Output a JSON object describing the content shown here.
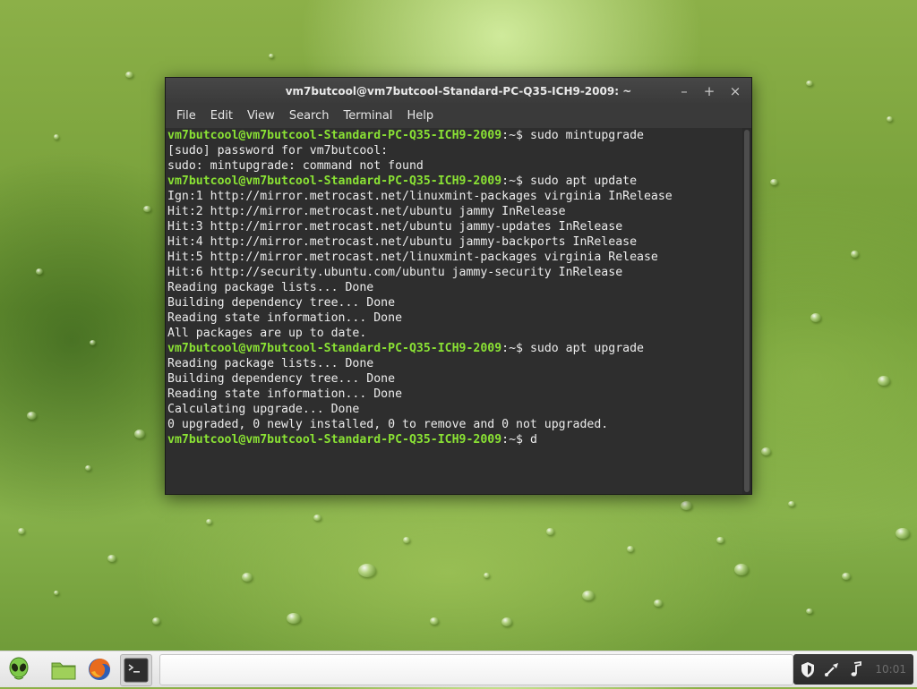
{
  "window": {
    "title": "vm7butcool@vm7butcool-Standard-PC-Q35-ICH9-2009: ~",
    "controls": {
      "minimize": "–",
      "maximize": "+",
      "close": "×"
    }
  },
  "menu": {
    "items": [
      {
        "label": "File"
      },
      {
        "label": "Edit"
      },
      {
        "label": "View"
      },
      {
        "label": "Search"
      },
      {
        "label": "Terminal"
      },
      {
        "label": "Help"
      }
    ]
  },
  "terminal": {
    "lines": [
      {
        "prompt": "vm7butcool@vm7butcool-Standard-PC-Q35-ICH9-2009",
        "sep": ":~$",
        "text": " sudo mintupgrade"
      },
      {
        "prompt": "",
        "sep": "",
        "text": "[sudo] password for vm7butcool:"
      },
      {
        "prompt": "",
        "sep": "",
        "text": "sudo: mintupgrade: command not found"
      },
      {
        "prompt": "vm7butcool@vm7butcool-Standard-PC-Q35-ICH9-2009",
        "sep": ":~$",
        "text": " sudo apt update"
      },
      {
        "prompt": "",
        "sep": "",
        "text": "Ign:1 http://mirror.metrocast.net/linuxmint-packages virginia InRelease"
      },
      {
        "prompt": "",
        "sep": "",
        "text": "Hit:2 http://mirror.metrocast.net/ubuntu jammy InRelease"
      },
      {
        "prompt": "",
        "sep": "",
        "text": "Hit:3 http://mirror.metrocast.net/ubuntu jammy-updates InRelease"
      },
      {
        "prompt": "",
        "sep": "",
        "text": "Hit:4 http://mirror.metrocast.net/ubuntu jammy-backports InRelease"
      },
      {
        "prompt": "",
        "sep": "",
        "text": "Hit:5 http://mirror.metrocast.net/linuxmint-packages virginia Release"
      },
      {
        "prompt": "",
        "sep": "",
        "text": "Hit:6 http://security.ubuntu.com/ubuntu jammy-security InRelease"
      },
      {
        "prompt": "",
        "sep": "",
        "text": "Reading package lists... Done"
      },
      {
        "prompt": "",
        "sep": "",
        "text": "Building dependency tree... Done"
      },
      {
        "prompt": "",
        "sep": "",
        "text": "Reading state information... Done"
      },
      {
        "prompt": "",
        "sep": "",
        "text": "All packages are up to date."
      },
      {
        "prompt": "vm7butcool@vm7butcool-Standard-PC-Q35-ICH9-2009",
        "sep": ":~$",
        "text": " sudo apt upgrade"
      },
      {
        "prompt": "",
        "sep": "",
        "text": "Reading package lists... Done"
      },
      {
        "prompt": "",
        "sep": "",
        "text": "Building dependency tree... Done"
      },
      {
        "prompt": "",
        "sep": "",
        "text": "Reading state information... Done"
      },
      {
        "prompt": "",
        "sep": "",
        "text": "Calculating upgrade... Done"
      },
      {
        "prompt": "",
        "sep": "",
        "text": "0 upgraded, 0 newly installed, 0 to remove and 0 not upgraded."
      },
      {
        "prompt": "vm7butcool@vm7butcool-Standard-PC-Q35-ICH9-2009",
        "sep": ":~$",
        "text": " d"
      }
    ]
  },
  "taskbar": {
    "launchers": [
      {
        "icon": "mint-menu-icon"
      },
      {
        "icon": "folder-icon"
      },
      {
        "icon": "firefox-icon"
      },
      {
        "icon": "terminal-icon"
      }
    ],
    "tray": [
      {
        "icon": "shield-icon"
      },
      {
        "icon": "network-icon"
      },
      {
        "icon": "volume-icon"
      }
    ],
    "clock": "10:01"
  },
  "colors": {
    "prompt": "#8ae234",
    "terminal_bg": "#2e2e2e",
    "terminal_fg": "#ececec",
    "titlebar": "#3f3f3f"
  }
}
